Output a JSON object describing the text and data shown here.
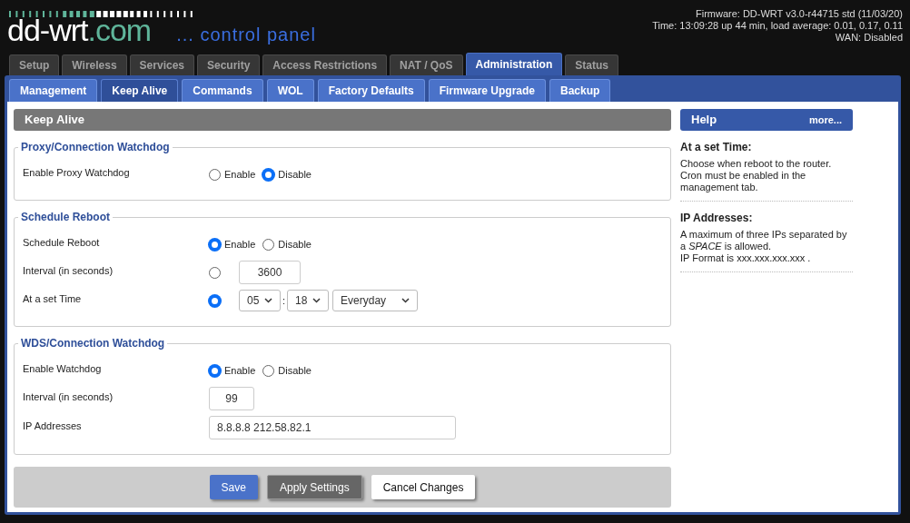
{
  "header": {
    "logo": {
      "main": "dd-wrt",
      "suffix": ".com",
      "tagline": "... control panel"
    },
    "status_lines": [
      "Firmware: DD-WRT v3.0-r44715 std (11/03/20)",
      "Time: 13:09:28 up 44 min, load average: 0.01, 0.17, 0.11",
      "WAN: Disabled"
    ]
  },
  "main_tabs": [
    {
      "label": "Setup",
      "selected": false
    },
    {
      "label": "Wireless",
      "selected": false
    },
    {
      "label": "Services",
      "selected": false
    },
    {
      "label": "Security",
      "selected": false
    },
    {
      "label": "Access Restrictions",
      "selected": false
    },
    {
      "label": "NAT / QoS",
      "selected": false
    },
    {
      "label": "Administration",
      "selected": true
    },
    {
      "label": "Status",
      "selected": false
    }
  ],
  "sub_tabs": [
    {
      "label": "Management",
      "selected": false
    },
    {
      "label": "Keep Alive",
      "selected": true
    },
    {
      "label": "Commands",
      "selected": false
    },
    {
      "label": "WOL",
      "selected": false
    },
    {
      "label": "Factory Defaults",
      "selected": false
    },
    {
      "label": "Firmware Upgrade",
      "selected": false
    },
    {
      "label": "Backup",
      "selected": false
    }
  ],
  "page_title": "Keep Alive",
  "sections": [
    {
      "legend": "Proxy/Connection Watchdog",
      "rows": [
        {
          "kind": "radio",
          "label": "Enable Proxy Watchdog",
          "options": [
            {
              "label": "Enable",
              "selected": false
            },
            {
              "label": "Disable",
              "selected": true
            }
          ]
        }
      ]
    },
    {
      "legend": "Schedule Reboot",
      "rows": [
        {
          "kind": "radio",
          "label": "Schedule Reboot",
          "options": [
            {
              "label": "Enable",
              "selected": true
            },
            {
              "label": "Disable",
              "selected": false
            }
          ]
        },
        {
          "kind": "radio_input",
          "label": "Interval (in seconds)",
          "selected": false,
          "value": "3600"
        },
        {
          "kind": "radio_time",
          "label": "At a set Time",
          "selected": true,
          "hour": "05",
          "separator": ":",
          "minute": "18",
          "day": "Everyday"
        }
      ]
    },
    {
      "legend": "WDS/Connection Watchdog",
      "rows": [
        {
          "kind": "radio",
          "label": "Enable Watchdog",
          "options": [
            {
              "label": "Enable",
              "selected": true
            },
            {
              "label": "Disable",
              "selected": false
            }
          ]
        },
        {
          "kind": "input_small",
          "label": "Interval (in seconds)",
          "value": "99"
        },
        {
          "kind": "input_wide",
          "label": "IP Addresses",
          "value": "8.8.8.8 212.58.82.1"
        }
      ]
    }
  ],
  "buttons": [
    {
      "label": "Save",
      "kind": "primary"
    },
    {
      "label": "Apply Settings",
      "kind": "secondary"
    },
    {
      "label": "Cancel Changes",
      "kind": "plain"
    }
  ],
  "help": {
    "title": "Help",
    "more": "more...",
    "entries": [
      {
        "heading": "At a set Time:",
        "lines": [
          "Choose when reboot to the router. Cron must be enabled in the management tab."
        ]
      },
      {
        "heading": "IP Addresses:",
        "lines": [
          "A maximum of three IPs separated by a *SPACE* is allowed.",
          "IP Format is xxx.xxx.xxx.xxx ."
        ]
      }
    ]
  }
}
